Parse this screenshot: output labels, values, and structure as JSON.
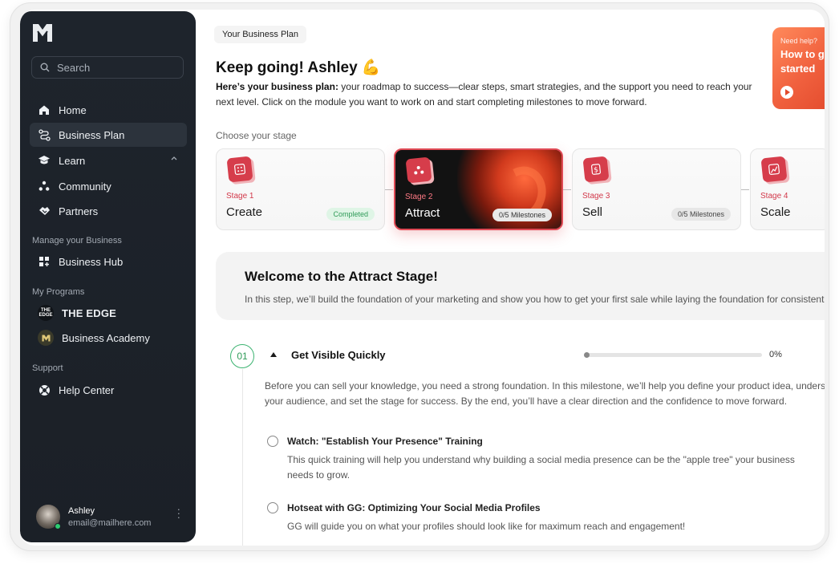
{
  "sidebar": {
    "search_placeholder": "Search",
    "nav": [
      {
        "label": "Home"
      },
      {
        "label": "Business Plan"
      },
      {
        "label": "Learn"
      },
      {
        "label": "Community"
      },
      {
        "label": "Partners"
      }
    ],
    "manage_label": "Manage your Business",
    "business_hub": "Business Hub",
    "programs_label": "My Programs",
    "programs": [
      {
        "label": "THE EDGE",
        "badge": "THE EDGE"
      },
      {
        "label": "Business Academy"
      }
    ],
    "support_label": "Support",
    "help_center": "Help Center",
    "user": {
      "name": "Ashley",
      "email": "email@mailhere.com"
    }
  },
  "main": {
    "breadcrumb": "Your Business Plan",
    "title": "Keep going! Ashley 💪",
    "intro_bold": "Here’s your business plan:",
    "intro_rest": " your roadmap to success—clear steps, smart strategies, and the support you need to reach your next level. Click on the module you want to work on and start completing milestones to move forward.",
    "help": {
      "small": "Need help?",
      "big": "How to get started"
    },
    "choose_label": "Choose your stage",
    "stages": [
      {
        "label": "Stage 1",
        "name": "Create",
        "badge": "Completed"
      },
      {
        "label": "Stage 2",
        "name": "Attract",
        "badge": "0/5 Milestones"
      },
      {
        "label": "Stage 3",
        "name": "Sell",
        "badge": "0/5 Milestones"
      },
      {
        "label": "Stage 4",
        "name": "Scale",
        "badge": ""
      }
    ],
    "welcome": {
      "title": "Welcome to the Attract Stage!",
      "text": "In this step, we’ll build the foundation of your marketing and show you how to get your first sale while laying the foundation for consistent growth."
    },
    "milestone": {
      "number": "01",
      "title": "Get Visible Quickly",
      "progress_percent": 0,
      "progress_label": "0%",
      "desc_line1": "Before you can sell your knowledge, you need a strong foundation. In this milestone, we’ll help you define your product idea, understand",
      "desc_line2": "your audience, and set the stage for success. By the end, you’ll have a clear direction and the confidence to move forward."
    },
    "tasks": [
      {
        "title": "Watch: \"Establish Your Presence\" Training",
        "desc": "This quick training will help you understand why building a social media presence can be the \"apple tree\" your business needs to grow."
      },
      {
        "title": "Hotseat with GG: Optimizing Your Social Media Profiles",
        "desc": "GG will guide you on what your profiles should look like for maximum reach and engagement!"
      }
    ]
  },
  "colors": {
    "sidebar_bg": "#1e242c",
    "accent_red": "#d63d4b",
    "success_green": "#2f9b58",
    "help_orange": "#f0603e"
  }
}
